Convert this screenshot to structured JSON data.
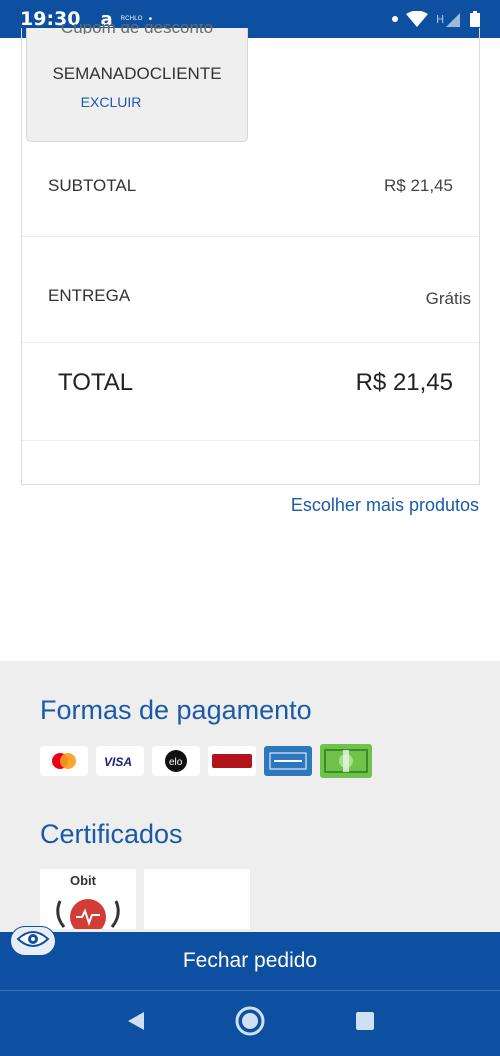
{
  "status_bar": {
    "time": "19:30",
    "app_letter": "a",
    "app_tiny": "RCHLO",
    "dot": "•"
  },
  "coupon": {
    "partial_label": "Cupom de desconto",
    "code": "SEMANADOCLIENTE",
    "remove_label": "EXCLUIR"
  },
  "summary": {
    "subtotal_label": "SUBTOTAL",
    "subtotal_value": "R$ 21,45",
    "delivery_label": "ENTREGA",
    "delivery_value": "Grátis",
    "total_label": "TOTAL",
    "total_value": "R$ 21,45"
  },
  "more_products_link": "Escolher mais produtos",
  "footer": {
    "payment_title": "Formas de pagamento",
    "payment_methods": [
      "mastercard",
      "visa",
      "elo",
      "hipercard",
      "american-express",
      "boleto"
    ],
    "certificates_title": "Certificados",
    "certificate_1_text": "Obit"
  },
  "checkout": {
    "label": "Fechar pedido"
  },
  "colors": {
    "brand_blue": "#0d4fa0",
    "link_blue": "#1a5aa8",
    "footer_gray": "#eeeeee"
  }
}
